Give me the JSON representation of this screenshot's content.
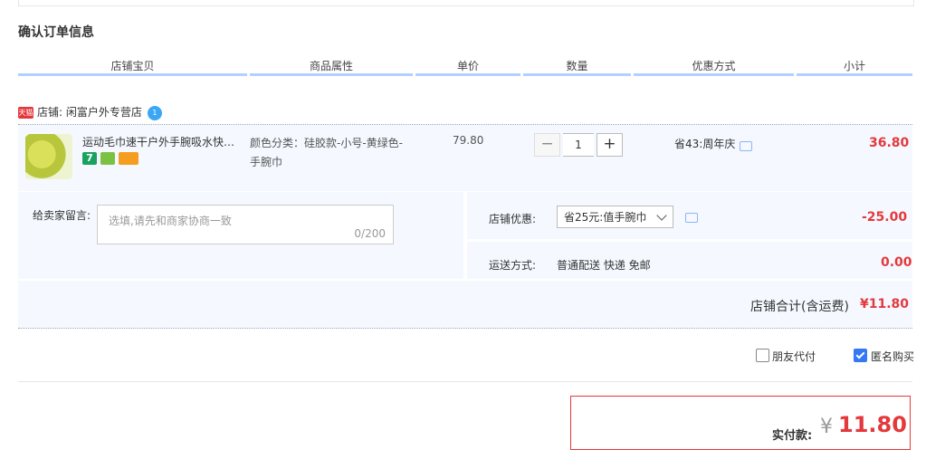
{
  "section_title": "确认订单信息",
  "columns": [
    "店铺宝贝",
    "商品属性",
    "单价",
    "数量",
    "优惠方式",
    "小计"
  ],
  "shop": {
    "badge": "天猫",
    "label": "店铺:",
    "name": "闲富户外专营店",
    "ww": "1"
  },
  "item": {
    "title": "运动毛巾速干户外手腕吸水快干毛巾",
    "service_icons": [
      "7-day-return-icon",
      "insurance-icon",
      "credit-card-icon"
    ],
    "attr_line1": "颜色分类：硅胶款-小号-黄绿色-",
    "attr_line2": "手腕巾",
    "price": "79.80",
    "qty": "1",
    "minus": "−",
    "plus": "+",
    "promo": "省43:周年庆",
    "subtotal": "36.80"
  },
  "message": {
    "label": "给卖家留言:",
    "placeholder": "选填,请先和商家协商一致",
    "counter": "0/200"
  },
  "shop_discount": {
    "label": "店铺优惠:",
    "selected": "省25元:值手腕巾",
    "amount": "-25.00"
  },
  "shipping": {
    "label": "运送方式:",
    "value": "普通配送 快递 免邮",
    "amount": "0.00"
  },
  "shop_total": {
    "label": "店铺合计(含运费)",
    "amount": "¥11.80"
  },
  "options": {
    "friend_pay": "朋友代付",
    "friend_pay_checked": false,
    "anonymous": "匿名购买",
    "anonymous_checked": true
  },
  "payment": {
    "label": "实付款:",
    "currency": "¥",
    "amount": "11.80"
  },
  "colors": {
    "accent_red": "#e4393c",
    "header_line": "#b2d1ff",
    "panel_bg": "#f5f9ff",
    "checkbox_blue": "#3478f6"
  }
}
